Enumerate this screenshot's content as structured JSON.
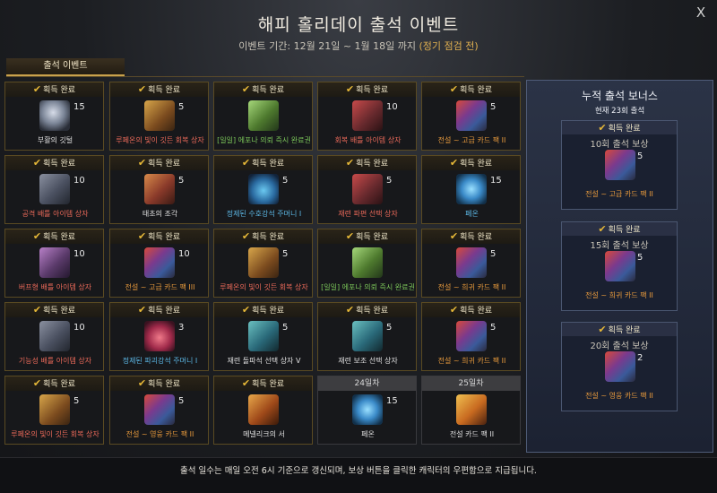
{
  "header": {
    "title": "해피 홀리데이 출석 이벤트",
    "period_prefix": "이벤트 기간: 12월 21일 ~ 1월 18일 까지",
    "period_highlight": "(정기 점검 전)",
    "close_label": "X"
  },
  "tab": {
    "label": "출석 이벤트"
  },
  "status": {
    "claimed": "획득 완료"
  },
  "days": [
    {
      "status": "claimed",
      "qty": "15",
      "name": "부활의 깃털",
      "grade": "white",
      "icon": "ic-feather"
    },
    {
      "status": "claimed",
      "qty": "5",
      "name": "루페온의 빛이 깃든 회복 상자",
      "grade": "red",
      "icon": "ic-chest-gold"
    },
    {
      "status": "claimed",
      "qty": "",
      "name": "[일일] 에포나 의뢰 즉시 완료권",
      "grade": "green",
      "icon": "ic-scroll-green"
    },
    {
      "status": "claimed",
      "qty": "10",
      "name": "회복 배틀 아이템 상자",
      "grade": "red",
      "icon": "ic-chest-red"
    },
    {
      "status": "claimed",
      "qty": "5",
      "name": "전설 ~ 고급 카드 팩 II",
      "grade": "orange",
      "icon": "ic-cards"
    },
    {
      "status": "claimed",
      "qty": "10",
      "name": "공격 배틀 아이템 상자",
      "grade": "red",
      "icon": "ic-chest-gray"
    },
    {
      "status": "claimed",
      "qty": "5",
      "name": "태초의 조각",
      "grade": "white",
      "icon": "ic-page"
    },
    {
      "status": "claimed",
      "qty": "5",
      "name": "정제된 수호강석 주머니 I",
      "grade": "blue",
      "icon": "ic-potion-blue"
    },
    {
      "status": "claimed",
      "qty": "5",
      "name": "재련 파편 선택 상자",
      "grade": "red",
      "icon": "ic-chest-red"
    },
    {
      "status": "claimed",
      "qty": "15",
      "name": "페온",
      "grade": "blue",
      "icon": "ic-orb"
    },
    {
      "status": "claimed",
      "qty": "10",
      "name": "버프형 배틀 아이템 상자",
      "grade": "red",
      "icon": "ic-chest-purple"
    },
    {
      "status": "claimed",
      "qty": "10",
      "name": "전설 ~ 고급 카드 팩 III",
      "grade": "orange",
      "icon": "ic-cards"
    },
    {
      "status": "claimed",
      "qty": "5",
      "name": "루페온의 빛이 깃든 회복 상자",
      "grade": "red",
      "icon": "ic-chest-gold"
    },
    {
      "status": "claimed",
      "qty": "",
      "name": "[일일] 에포나 의뢰 즉시 완료권",
      "grade": "green",
      "icon": "ic-scroll-green"
    },
    {
      "status": "claimed",
      "qty": "5",
      "name": "전설 ~ 희귀 카드 팩 II",
      "grade": "orange",
      "icon": "ic-cards"
    },
    {
      "status": "claimed",
      "qty": "10",
      "name": "기능성 배틀 아이템 상자",
      "grade": "red",
      "icon": "ic-chest-gray"
    },
    {
      "status": "claimed",
      "qty": "3",
      "name": "정제된 파괴강석 주머니 I",
      "grade": "blue",
      "icon": "ic-potion-red"
    },
    {
      "status": "claimed",
      "qty": "5",
      "name": "재련 돌파석 선택 상자 V",
      "grade": "white",
      "icon": "ic-chest-teal"
    },
    {
      "status": "claimed",
      "qty": "5",
      "name": "재련 보조 선택 상자",
      "grade": "white",
      "icon": "ic-chest-teal"
    },
    {
      "status": "claimed",
      "qty": "5",
      "name": "전설 ~ 희귀 카드 팩 II",
      "grade": "orange",
      "icon": "ic-cards"
    },
    {
      "status": "claimed",
      "qty": "5",
      "name": "루페온의 빛이 깃든 회복 상자",
      "grade": "red",
      "icon": "ic-chest-gold"
    },
    {
      "status": "claimed",
      "qty": "5",
      "name": "전설 ~ 영웅 카드 팩 II",
      "grade": "orange",
      "icon": "ic-cards"
    },
    {
      "status": "claimed",
      "qty": "",
      "name": "메넬리크의 서",
      "grade": "white",
      "icon": "ic-magic-book"
    },
    {
      "status": "future",
      "day_label": "24일차",
      "qty": "15",
      "name": "페온",
      "grade": "white",
      "icon": "ic-orb"
    },
    {
      "status": "future",
      "day_label": "25일차",
      "qty": "",
      "name": "전설 카드 팩 II",
      "grade": "white",
      "icon": "ic-book"
    }
  ],
  "sidebar": {
    "title": "누적 출석 보너스",
    "current": "현재 23회 출석",
    "bonuses": [
      {
        "status": "획득 완료",
        "title": "10회 출석 보상",
        "qty": "5",
        "name": "전설 ~ 고급 카드 팩 II",
        "icon": "ic-cards"
      },
      {
        "status": "획득 완료",
        "title": "15회 출석 보상",
        "qty": "5",
        "name": "전설 ~ 희귀 카드 팩 II",
        "icon": "ic-cards"
      },
      {
        "status": "획득 완료",
        "title": "20회 출석 보상",
        "qty": "2",
        "name": "전설 ~ 영웅 카드 팩 II",
        "icon": "ic-cards"
      }
    ]
  },
  "footer": {
    "note": "출석 일수는 매일 오전 6시 기준으로 갱신되며, 보상 버튼을 클릭한 캐릭터의 우편함으로 지급됩니다."
  },
  "colors": {
    "accent_gold": "#e6b838",
    "grade_orange": "#e89a3c",
    "grade_blue": "#5cb8e6",
    "grade_green": "#7cc85a",
    "grade_red": "#ec6a5a"
  }
}
